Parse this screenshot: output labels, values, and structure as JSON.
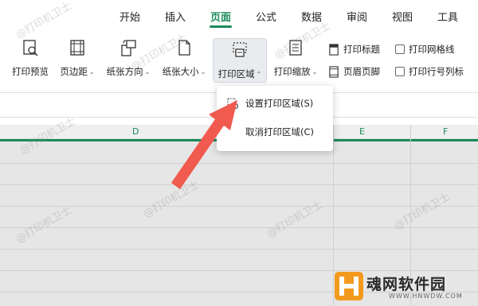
{
  "menu": {
    "tabs": [
      "开始",
      "插入",
      "页面",
      "公式",
      "数据",
      "审阅",
      "视图",
      "工具"
    ],
    "active": "页面"
  },
  "ribbon": {
    "print_preview": "打印预览",
    "margins": "页边距",
    "orientation": "纸张方向",
    "paper_size": "纸张大小",
    "print_area": "打印区域",
    "print_scaling": "打印缩放",
    "print_titles": "打印标题",
    "header_footer": "页眉页脚",
    "print_gridlines": "打印网格线",
    "print_row_col_headers": "打印行号列标"
  },
  "grid": {
    "columns": [
      "D",
      "E",
      "F"
    ]
  },
  "dropdown": {
    "items": [
      "设置打印区域(S)",
      "取消打印区域(C)"
    ]
  },
  "watermark": "@打印机卫士",
  "logo": {
    "name": "魂网软件园",
    "url": "WWW.HNWDW.COM"
  },
  "colors": {
    "accent": "#1a8a5a",
    "arrow": "#f05a4f",
    "logo_orange": "#f39a1e"
  }
}
